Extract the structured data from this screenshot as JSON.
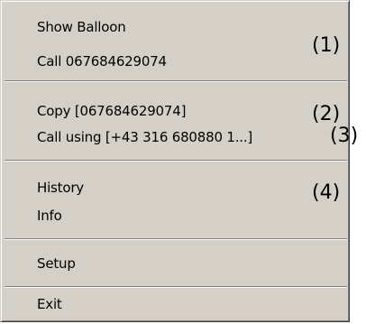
{
  "menu": {
    "items": [
      {
        "label": "Show Balloon"
      },
      {
        "label": "Call 067684629074"
      },
      {
        "label": "Copy  [067684629074]"
      },
      {
        "label": "Call using [+43 316 680880 1...]"
      },
      {
        "label": "History"
      },
      {
        "label": "Info"
      },
      {
        "label": "Setup"
      },
      {
        "label": "Exit"
      }
    ]
  },
  "annotations": [
    "(1)",
    "(2)",
    "(3)",
    "(4)"
  ]
}
